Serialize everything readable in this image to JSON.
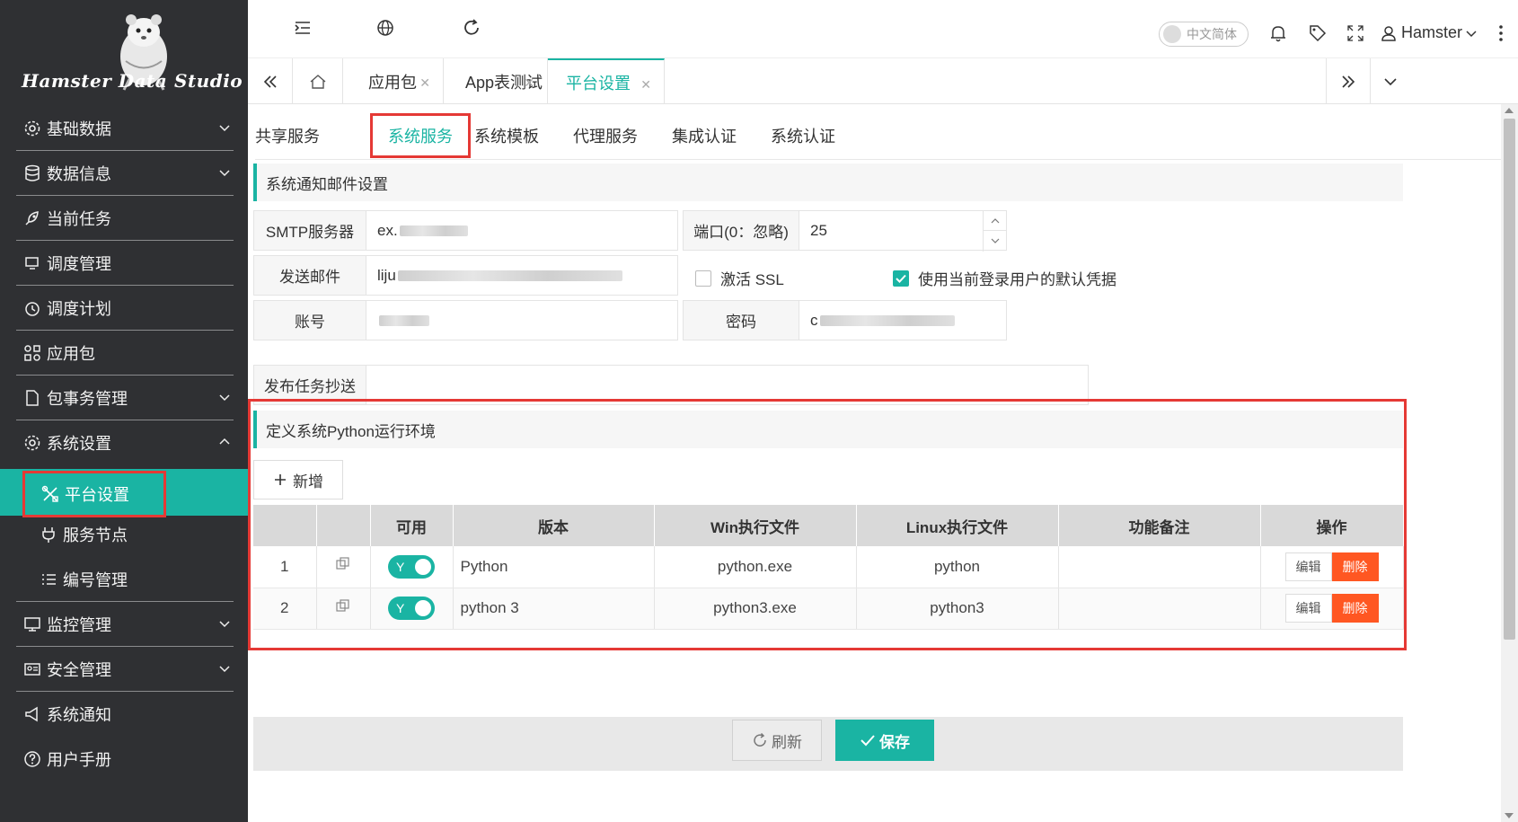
{
  "app": {
    "logo_text_left": "Hamster Data",
    "logo_text_right": "Studio"
  },
  "sidebar": {
    "items": [
      {
        "label": "基础数据",
        "icon": "gear-icon",
        "has_chevron": true,
        "expanded": false
      },
      {
        "label": "数据信息",
        "icon": "database-icon",
        "has_chevron": true,
        "expanded": false
      },
      {
        "label": "当前任务",
        "icon": "rocket-icon",
        "has_chevron": false
      },
      {
        "label": "调度管理",
        "icon": "monitor-icon",
        "has_chevron": false
      },
      {
        "label": "调度计划",
        "icon": "clock-icon",
        "has_chevron": false
      },
      {
        "label": "应用包",
        "icon": "apps-icon",
        "has_chevron": false
      },
      {
        "label": "包事务管理",
        "icon": "file-icon",
        "has_chevron": true,
        "expanded": false
      },
      {
        "label": "系统设置",
        "icon": "gear-icon",
        "has_chevron": true,
        "expanded": true
      }
    ],
    "submenu": [
      {
        "label": "平台设置",
        "icon": "tools-icon",
        "active": true
      },
      {
        "label": "服务节点",
        "icon": "plug-icon"
      },
      {
        "label": "编号管理",
        "icon": "list-icon"
      }
    ],
    "items_after": [
      {
        "label": "监控管理",
        "icon": "monitor-icon",
        "has_chevron": true
      },
      {
        "label": "安全管理",
        "icon": "id-card-icon",
        "has_chevron": true
      },
      {
        "label": "系统通知",
        "icon": "megaphone-icon",
        "has_chevron": false
      },
      {
        "label": "用户手册",
        "icon": "help-icon",
        "has_chevron": false
      }
    ]
  },
  "topbar": {
    "language": "中文简体",
    "user": "Hamster"
  },
  "tabs": [
    {
      "label": "应用包",
      "active": false
    },
    {
      "label": "App表测试",
      "active": false
    },
    {
      "label": "平台设置",
      "active": true
    }
  ],
  "subtabs": {
    "items": [
      "共享服务",
      "系统服务",
      "系统模板",
      "代理服务",
      "集成认证",
      "系统认证"
    ],
    "active": "系统服务"
  },
  "email_section": {
    "title": "系统通知邮件设置",
    "smtp_label": "SMTP服务器",
    "smtp_value": "ex.",
    "port_label": "端口(0：忽略)",
    "port_value": "25",
    "sender_label": "发送邮件",
    "sender_value": "liju",
    "ssl_label": "激活 SSL",
    "ssl_checked": false,
    "default_cred_label": "使用当前登录用户的默认凭据",
    "default_cred_checked": true,
    "account_label": "账号",
    "account_value": "",
    "password_label": "密码",
    "password_value": "c",
    "cc_label": "发布任务抄送",
    "cc_value": ""
  },
  "python_section": {
    "title": "定义系统Python运行环境",
    "add_label": "新增",
    "columns": [
      "",
      "",
      "可用",
      "版本",
      "Win执行文件",
      "Linux执行文件",
      "功能备注",
      "操作"
    ],
    "rows": [
      {
        "index": "1",
        "enabled": "Y",
        "version": "Python",
        "win": "python.exe",
        "linux": "python",
        "note": ""
      },
      {
        "index": "2",
        "enabled": "Y",
        "version": "python 3",
        "win": "python3.exe",
        "linux": "python3",
        "note": ""
      }
    ],
    "edit_label": "编辑",
    "delete_label": "删除"
  },
  "footer": {
    "refresh_label": "刷新",
    "save_label": "保存"
  },
  "colors": {
    "sidebar_bg": "#2f3033",
    "accent": "#1ab4a3",
    "highlight_frame": "#e53935",
    "delete_btn": "#ff5722"
  }
}
